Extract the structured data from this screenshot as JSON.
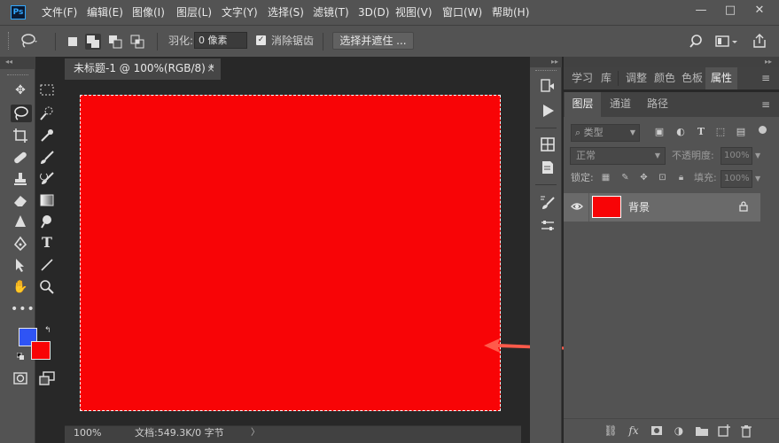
{
  "app": {
    "logo": "Ps"
  },
  "menu": [
    "文件(F)",
    "编辑(E)",
    "图像(I)",
    "图层(L)",
    "文字(Y)",
    "选择(S)",
    "滤镜(T)",
    "3D(D)",
    "视图(V)",
    "窗口(W)",
    "帮助(H)"
  ],
  "window_controls": {
    "minimize": "—",
    "maximize": "□",
    "close": "✕"
  },
  "options": {
    "feather_label": "羽化:",
    "feather_value": "0 像素",
    "antialias_label": "消除锯齿",
    "antialias_checked": true,
    "select_mask_label": "选择并遮住 ..."
  },
  "document": {
    "tab_title": "未标题-1 @ 100%(RGB/8) *",
    "tab_close": "×",
    "zoom": "100%",
    "info": "文档:549.3K/0 字节",
    "info_arrow": "〉",
    "canvas_color": "#f80406"
  },
  "colors": {
    "foreground": "#2f54f5",
    "background": "#f80406"
  },
  "panels": {
    "top_tabs": [
      "学习",
      "库",
      "调整",
      "颜色",
      "色板",
      "属性"
    ],
    "active_top_tab": "属性",
    "layer_tabs": [
      "图层",
      "通道",
      "路径"
    ],
    "active_layer_tab": "图层",
    "filter_placeholder": "类型",
    "blend_mode": "正常",
    "opacity_label": "不透明度:",
    "opacity_value": "100%",
    "lock_label": "锁定:",
    "fill_label": "填充:",
    "fill_value": "100%"
  },
  "layers": [
    {
      "name": "背景",
      "visible": true,
      "locked": true,
      "thumb_color": "#f80406"
    }
  ]
}
